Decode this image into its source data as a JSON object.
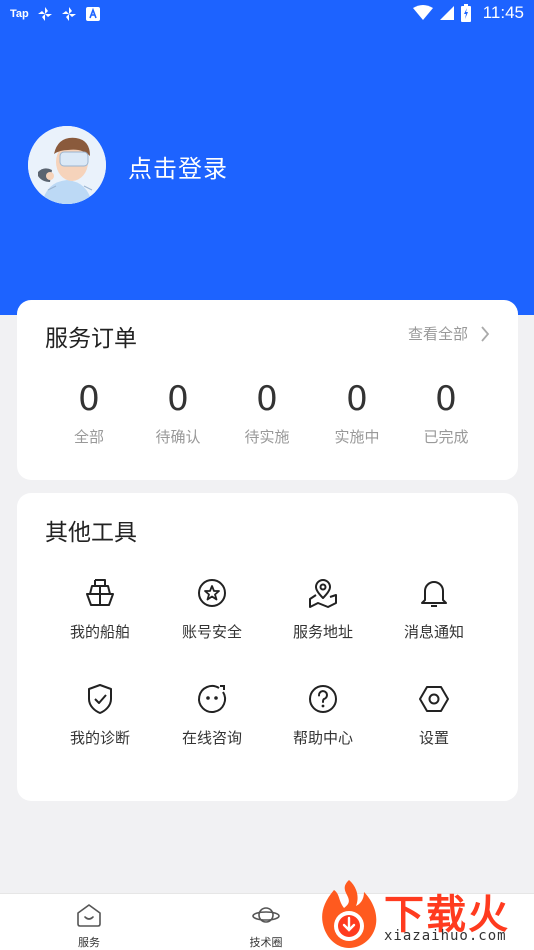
{
  "status_bar": {
    "left_text": "Tap",
    "left_icons": [
      "pinwheel-icon",
      "pinwheel-icon",
      "a-box-icon"
    ],
    "right_icons": [
      "wifi-icon",
      "signal-icon",
      "battery-icon"
    ],
    "time": "11:45"
  },
  "header": {
    "login_text": "点击登录",
    "background_color": "#1d63ff"
  },
  "orders": {
    "title": "服务订单",
    "view_all": "查看全部",
    "items": [
      {
        "count": "0",
        "label": "全部"
      },
      {
        "count": "0",
        "label": "待确认"
      },
      {
        "count": "0",
        "label": "待实施"
      },
      {
        "count": "0",
        "label": "实施中"
      },
      {
        "count": "0",
        "label": "已完成"
      }
    ]
  },
  "tools": {
    "title": "其他工具",
    "items": [
      {
        "label": "我的船舶",
        "icon": "ship-icon"
      },
      {
        "label": "账号安全",
        "icon": "star-circle-icon"
      },
      {
        "label": "服务地址",
        "icon": "map-pin-icon"
      },
      {
        "label": "消息通知",
        "icon": "bell-icon"
      },
      {
        "label": "我的诊断",
        "icon": "shield-check-icon"
      },
      {
        "label": "在线咨询",
        "icon": "chat-face-icon"
      },
      {
        "label": "帮助中心",
        "icon": "help-circle-icon"
      },
      {
        "label": "设置",
        "icon": "hexagon-settings-icon"
      }
    ]
  },
  "tabbar": {
    "items": [
      {
        "label": "服务",
        "icon": "service-home-icon"
      },
      {
        "label": "技术圈",
        "icon": "planet-icon"
      }
    ]
  },
  "watermark": {
    "text": "下载火",
    "url": "xiazaihuo.com"
  }
}
